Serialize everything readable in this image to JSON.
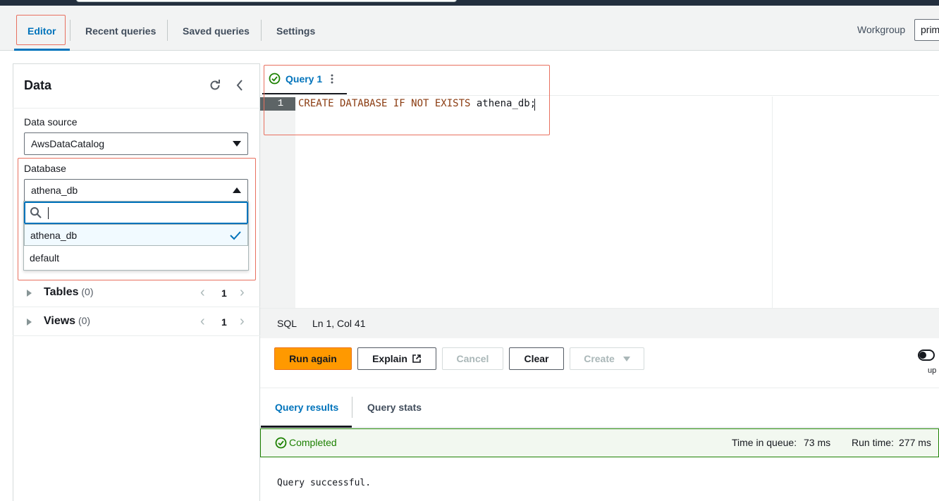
{
  "tabs": {
    "editor": "Editor",
    "recent": "Recent queries",
    "saved": "Saved queries",
    "settings": "Settings"
  },
  "workgroup": {
    "label": "Workgroup",
    "value": "prim"
  },
  "data_panel": {
    "title": "Data",
    "data_source_label": "Data source",
    "data_source_value": "AwsDataCatalog",
    "database_label": "Database",
    "database_value": "athena_db",
    "search_placeholder": "",
    "options": [
      "athena_db",
      "default"
    ],
    "selected_option": "athena_db",
    "tree": [
      {
        "label": "Tables",
        "count": "(0)",
        "page": "1"
      },
      {
        "label": "Views",
        "count": "(0)",
        "page": "1"
      }
    ]
  },
  "editor": {
    "query_tab": "Query 1",
    "line_number": "1",
    "code_kw1": "CREATE DATABASE IF NOT EXISTS",
    "code_rest": " athena_db;",
    "language": "SQL",
    "cursor_pos": "Ln 1, Col 41"
  },
  "actions": {
    "run": "Run again",
    "explain": "Explain",
    "cancel": "Cancel",
    "clear": "Clear",
    "create": "Create",
    "toggle_caption": "up"
  },
  "results": {
    "tab_results": "Query results",
    "tab_stats": "Query stats",
    "status": "Completed",
    "queue_label": "Time in queue:",
    "queue_value": "73 ms",
    "run_label": "Run time:",
    "run_value": "277 ms",
    "message": "Query successful."
  },
  "colors": {
    "accent": "#0073bb",
    "primary_button": "#ff9900",
    "success": "#1d8102",
    "highlight": "#e8705f"
  }
}
